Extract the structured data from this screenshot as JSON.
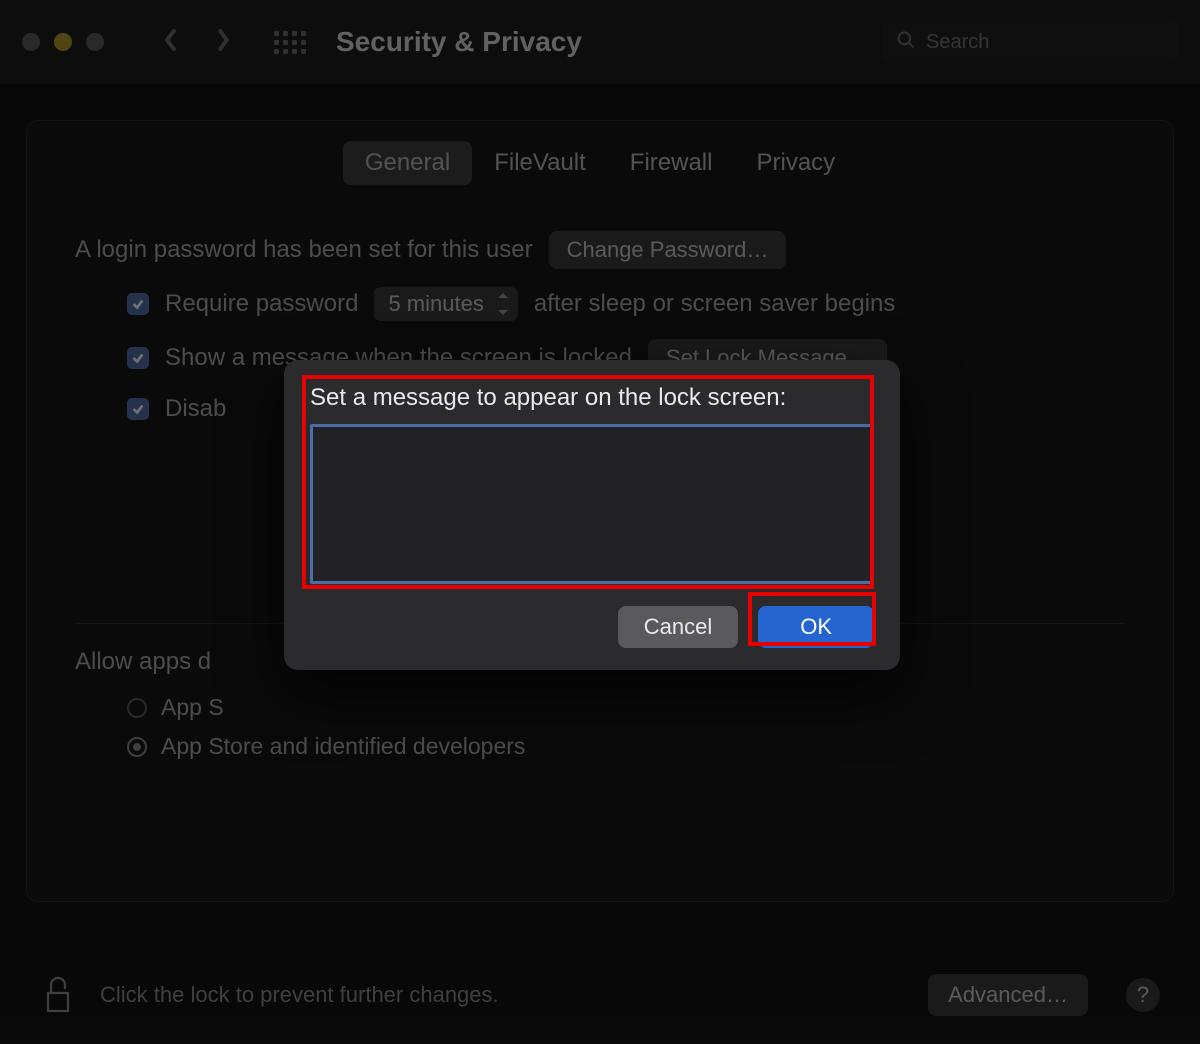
{
  "window": {
    "title": "Security & Privacy"
  },
  "search": {
    "placeholder": "Search",
    "value": ""
  },
  "tabs": [
    {
      "label": "General",
      "active": true
    },
    {
      "label": "FileVault",
      "active": false
    },
    {
      "label": "Firewall",
      "active": false
    },
    {
      "label": "Privacy",
      "active": false
    }
  ],
  "general": {
    "login_pw_text": "A login password has been set for this user",
    "change_pw_btn": "Change Password…",
    "require_pw_label": "Require password",
    "require_pw_delay": "5 minutes",
    "require_pw_after": "after sleep or screen saver begins",
    "show_msg_label": "Show a message when the screen is locked",
    "set_lock_msg_btn": "Set Lock Message…",
    "disable_autologin_label": "Disab",
    "allow_apps_label": "Allow apps d",
    "radio_appstore": "App S",
    "radio_identified": "App Store and identified developers"
  },
  "footer": {
    "lock_text": "Click the lock to prevent further changes.",
    "advanced_btn": "Advanced…",
    "help_glyph": "?"
  },
  "sheet": {
    "prompt": "Set a message to appear on the lock screen:",
    "value": "",
    "cancel": "Cancel",
    "ok": "OK"
  }
}
